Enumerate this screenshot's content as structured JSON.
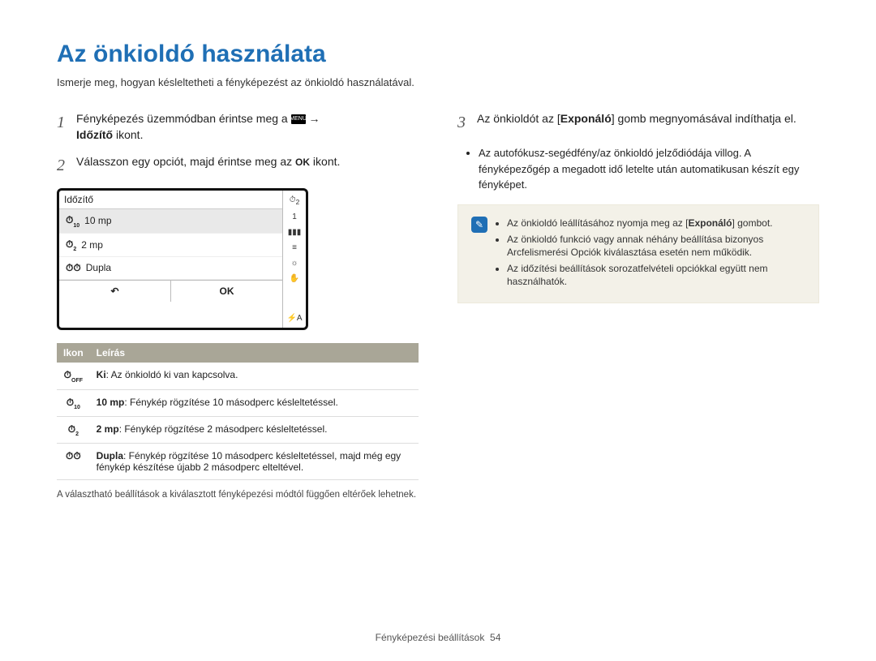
{
  "title": "Az önkioldó használata",
  "subtitle": "Ismerje meg, hogyan késleltetheti a fényképezést az önkioldó használatával.",
  "steps": {
    "s1": {
      "num": "1",
      "pre": "Fényképezés üzemmódban érintse meg a ",
      "menu": "MENU",
      "arrow": " → ",
      "bold": "Időzítő",
      "post": " ikont."
    },
    "s2": {
      "num": "2",
      "pre": "Válasszon egy opciót, majd érintse meg az ",
      "ok": "OK",
      "post": " ikont."
    },
    "s3": {
      "num": "3",
      "pre": "Az önkioldót az [",
      "bold": "Exponáló",
      "post": "] gomb megnyomásával indíthatja el."
    }
  },
  "timer_screen": {
    "header": "Időzítő",
    "rows": [
      {
        "icon": "⏱10",
        "label": "10 mp"
      },
      {
        "icon": "⏱2",
        "label": "2 mp"
      },
      {
        "icon": "⏱⏱",
        "label": "Dupla"
      }
    ],
    "back": "↶",
    "ok": "OK",
    "side_top_icon": "⏱2",
    "side_top_num": "1",
    "side_icons": [
      "▮▮▮",
      "≡",
      "☼",
      "✋"
    ],
    "side_bottom": "⚡A"
  },
  "icon_table": {
    "h1": "Ikon",
    "h2": "Leírás",
    "rows": [
      {
        "icon": "⏱OFF",
        "bold": "Ki",
        "text": ": Az önkioldó ki van kapcsolva."
      },
      {
        "icon": "⏱10",
        "bold": "10 mp",
        "text": ": Fénykép rögzítése 10 másodperc késleltetéssel."
      },
      {
        "icon": "⏱2",
        "bold": "2 mp",
        "text": ": Fénykép rögzítése 2 másodperc késleltetéssel."
      },
      {
        "icon": "⏱⏱",
        "bold": "Dupla",
        "text": ": Fénykép rögzítése 10 másodperc késleltetéssel, majd még egy fénykép készítése újabb 2 másodperc elteltével."
      }
    ]
  },
  "caption": "A választható beállítások a kiválasztott fényképezési módtól függően eltérőek lehetnek.",
  "bullets": [
    "Az autofókusz-segédfény/az önkioldó jelződiódája villog. A fényképezőgép a megadott idő letelte után automatikusan készít egy fényképet."
  ],
  "note": {
    "items": [
      {
        "pre": "Az önkioldó leállításához nyomja meg az [",
        "bold": "Exponáló",
        "post": "] gombot."
      },
      {
        "pre": "Az önkioldó funkció vagy annak néhány beállítása bizonyos Arcfelismerési Opciók kiválasztása esetén nem működik.",
        "bold": "",
        "post": ""
      },
      {
        "pre": "Az időzítési beállítások sorozatfelvételi opciókkal együtt nem használhatók.",
        "bold": "",
        "post": ""
      }
    ]
  },
  "footer": {
    "section": "Fényképezési beállítások",
    "page": "54"
  }
}
